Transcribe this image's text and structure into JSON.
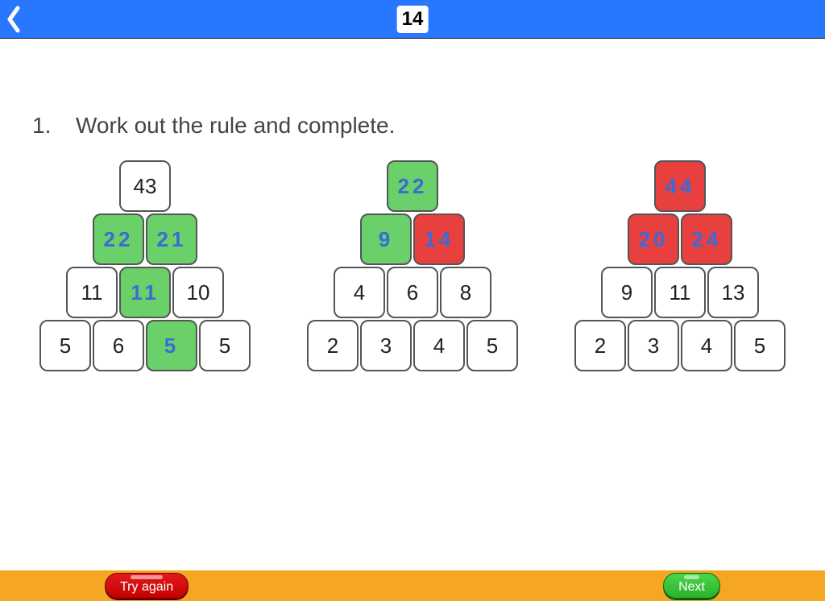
{
  "header": {
    "page_number": "14"
  },
  "question": {
    "number": "1.",
    "text": "Work out the rule and complete."
  },
  "pyramids": [
    {
      "rows": [
        [
          {
            "v": "43",
            "s": "given"
          }
        ],
        [
          {
            "v": "22",
            "s": "correct"
          },
          {
            "v": "21",
            "s": "correct"
          }
        ],
        [
          {
            "v": "11",
            "s": "given"
          },
          {
            "v": "11",
            "s": "correct"
          },
          {
            "v": "10",
            "s": "given"
          }
        ],
        [
          {
            "v": "5",
            "s": "given"
          },
          {
            "v": "6",
            "s": "given"
          },
          {
            "v": "5",
            "s": "correct"
          },
          {
            "v": "5",
            "s": "given"
          }
        ]
      ]
    },
    {
      "rows": [
        [
          {
            "v": "22",
            "s": "correct"
          }
        ],
        [
          {
            "v": "9",
            "s": "correct"
          },
          {
            "v": "14",
            "s": "wrong"
          }
        ],
        [
          {
            "v": "4",
            "s": "given"
          },
          {
            "v": "6",
            "s": "given"
          },
          {
            "v": "8",
            "s": "given"
          }
        ],
        [
          {
            "v": "2",
            "s": "given"
          },
          {
            "v": "3",
            "s": "given"
          },
          {
            "v": "4",
            "s": "given"
          },
          {
            "v": "5",
            "s": "given"
          }
        ]
      ]
    },
    {
      "rows": [
        [
          {
            "v": "44",
            "s": "wrong"
          }
        ],
        [
          {
            "v": "20",
            "s": "wrong"
          },
          {
            "v": "24",
            "s": "wrong"
          }
        ],
        [
          {
            "v": "9",
            "s": "given"
          },
          {
            "v": "11",
            "s": "given"
          },
          {
            "v": "13",
            "s": "given"
          }
        ],
        [
          {
            "v": "2",
            "s": "given"
          },
          {
            "v": "3",
            "s": "given"
          },
          {
            "v": "4",
            "s": "given"
          },
          {
            "v": "5",
            "s": "given"
          }
        ]
      ]
    }
  ],
  "footer": {
    "try_again": "Try again",
    "next": "Next"
  }
}
